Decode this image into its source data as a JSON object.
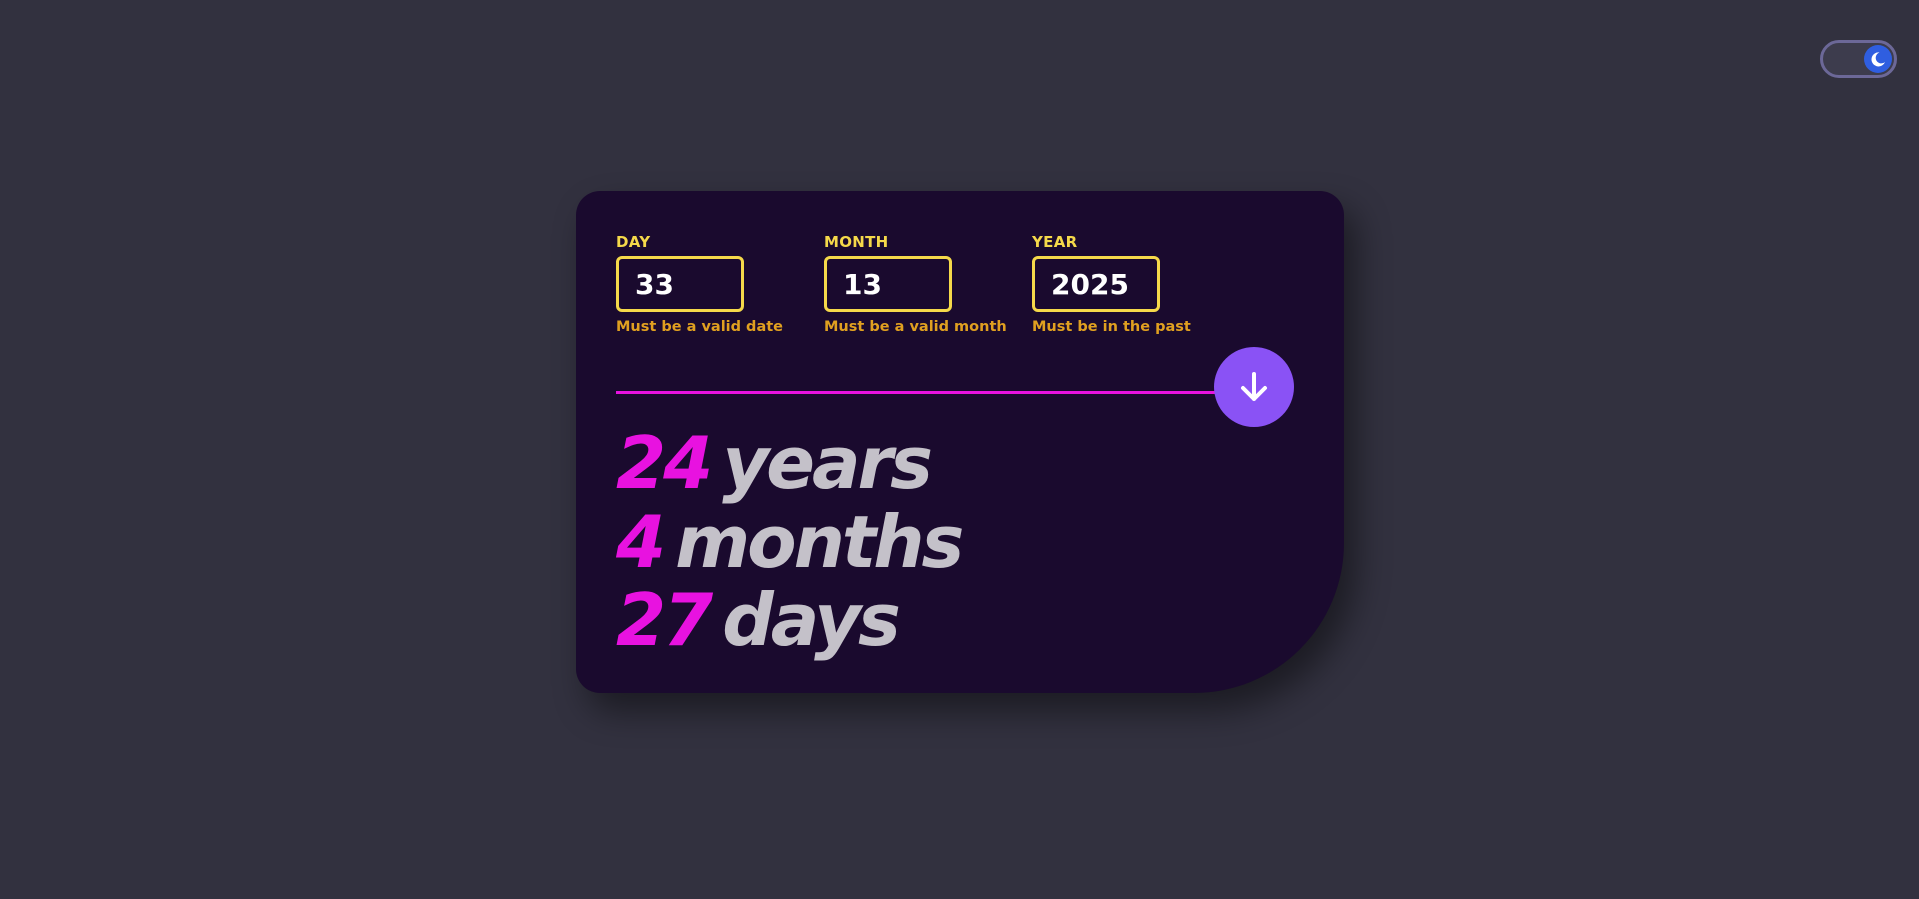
{
  "theme_toggle": {
    "icon": "moon-icon",
    "state": "dark"
  },
  "form": {
    "day": {
      "label": "DAY",
      "value": "33",
      "error": "Must be a valid date"
    },
    "month": {
      "label": "MONTH",
      "value": "13",
      "error": "Must be a valid month"
    },
    "year": {
      "label": "YEAR",
      "value": "2025",
      "error": "Must be in the past"
    }
  },
  "submit": {
    "icon": "arrow-down-icon"
  },
  "result": {
    "years": {
      "value": "24",
      "unit": "years"
    },
    "months": {
      "value": "4",
      "unit": "months"
    },
    "days": {
      "value": "27",
      "unit": "days"
    }
  },
  "colors": {
    "background": "#32313f",
    "card": "#1a0a2e",
    "accent_magenta": "#e812e0",
    "accent_purple": "#8a52f5",
    "label_yellow": "#f5d94a",
    "error_orange": "#e0a020",
    "unit_gray": "#c4c1c9",
    "toggle_blue": "#2f5ee0"
  }
}
